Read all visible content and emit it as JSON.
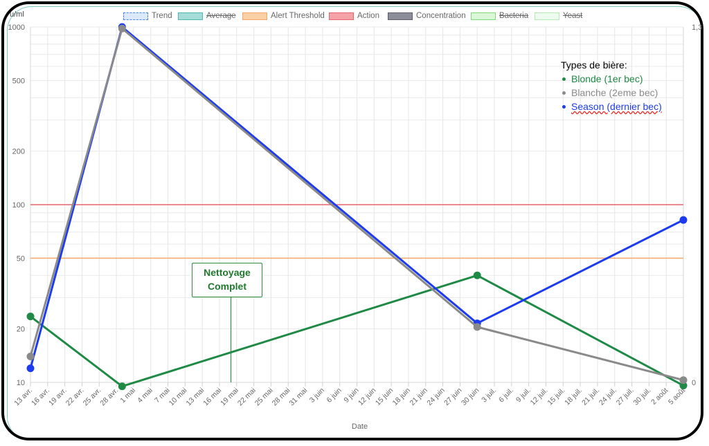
{
  "legend": [
    {
      "key": "trend",
      "label": "Trend",
      "fill": "#dbe9fb",
      "stroke": "#4a86e8",
      "dashed": true,
      "hidden": false
    },
    {
      "key": "average",
      "label": "Average",
      "fill": "#a6dcd8",
      "stroke": "#4bb8b1",
      "dashed": false,
      "hidden": true
    },
    {
      "key": "alert",
      "label": "Alert Threshold",
      "fill": "#fbd0a7",
      "stroke": "#f3a867",
      "dashed": false,
      "hidden": false
    },
    {
      "key": "action",
      "label": "Action",
      "fill": "#f4a1a8",
      "stroke": "#e7646c",
      "dashed": false,
      "hidden": false
    },
    {
      "key": "concentration",
      "label": "Concentration",
      "fill": "#8b8d99",
      "stroke": "#5c5e6b",
      "dashed": false,
      "hidden": false
    },
    {
      "key": "bacteria",
      "label": "Bacteria",
      "fill": "#dbf7d8",
      "stroke": "#7fd977",
      "dashed": false,
      "hidden": true
    },
    {
      "key": "yeast",
      "label": "Yeast",
      "fill": "#eefbef",
      "stroke": "#b6eab3",
      "dashed": false,
      "hidden": true
    }
  ],
  "types": {
    "title": "Types de bière:",
    "items": [
      {
        "label": "Blonde (1er bec)",
        "color": "#1f8a45"
      },
      {
        "label": "Blanche (2eme bec)",
        "color": "#8a8a8a"
      },
      {
        "label": "Season (dernier bec)",
        "color": "#1d3bf0"
      }
    ]
  },
  "annotation": {
    "line1": "Nettoyage",
    "line2": "Complet",
    "date": "2025-05-18"
  },
  "chart_data": {
    "type": "line",
    "xlabel": "Date",
    "ylabel_left": "ufc/ml",
    "ylabel_left_shown": "u/ml",
    "yscale": "log",
    "ylim": [
      10,
      1000
    ],
    "y_ticks": [
      {
        "value": 1000,
        "label": "1000"
      },
      {
        "value": 500,
        "label": "500"
      },
      {
        "value": 200,
        "label": "200"
      },
      {
        "value": 100,
        "label": "100"
      },
      {
        "value": 50,
        "label": "50"
      },
      {
        "value": 20,
        "label": "20"
      },
      {
        "value": 10,
        "label": "10"
      }
    ],
    "y2_ticks": [
      {
        "label": "1,3"
      },
      {
        "label": "0"
      }
    ],
    "x_start": "2025-04-13",
    "x_end": "2025-08-05",
    "x_ticks": [
      "13 avr.",
      "16 avr.",
      "19 avr.",
      "22 avr.",
      "25 avr.",
      "28 avr.",
      "1 mai",
      "4 mai",
      "7 mai",
      "10 mai",
      "13 mai",
      "16 mai",
      "19 mai",
      "22 mai",
      "25 mai",
      "28 mai",
      "31 mai",
      "3 juin",
      "6 juin",
      "9 juin",
      "12 juin",
      "15 juin",
      "18 juin",
      "21 juin",
      "24 juin",
      "27 juin",
      "30 juin",
      "3 juil.",
      "6 juil.",
      "9 juil.",
      "12 juil.",
      "15 juil.",
      "18 juil.",
      "21 juil.",
      "24 juil.",
      "27 juil.",
      "30 juil.",
      "2 août",
      "5 août"
    ],
    "thresholds": [
      {
        "name": "Action",
        "value": 100,
        "color": "#e7646c"
      },
      {
        "name": "Alert Threshold",
        "value": 50,
        "color": "#f3a867"
      }
    ],
    "series": [
      {
        "name": "Blonde (1er bec)",
        "color": "#1f8a45",
        "points": [
          [
            "2025-04-13",
            23.5
          ],
          [
            "2025-04-29",
            9.5
          ],
          [
            "2025-06-30",
            40
          ],
          [
            "2025-08-05",
            9.6
          ]
        ]
      },
      {
        "name": "Season (dernier bec)",
        "color": "#1d3bf0",
        "points": [
          [
            "2025-04-13",
            12
          ],
          [
            "2025-04-29",
            1000
          ],
          [
            "2025-06-30",
            21.5
          ],
          [
            "2025-08-05",
            82
          ]
        ]
      },
      {
        "name": "Blanche (2eme bec)",
        "color": "#8a8a8a",
        "points": [
          [
            "2025-04-13",
            14
          ],
          [
            "2025-04-29",
            980
          ],
          [
            "2025-06-30",
            20.5
          ],
          [
            "2025-08-05",
            10.3
          ]
        ]
      }
    ]
  }
}
